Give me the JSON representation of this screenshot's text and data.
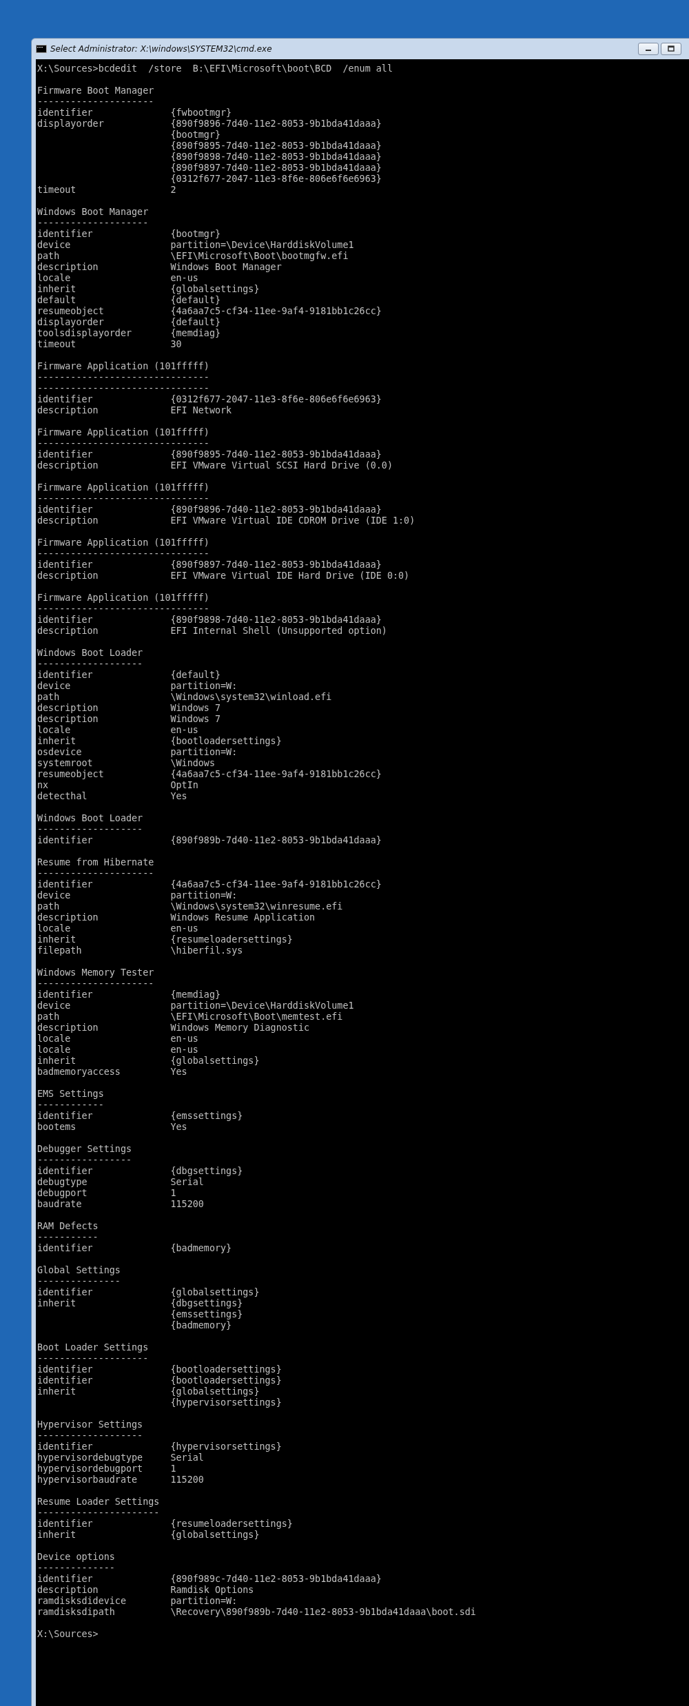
{
  "window": {
    "title": "Select Administrator: X:\\windows\\SYSTEM32\\cmd.exe"
  },
  "console": {
    "command_line": "X:\\Sources>bcdedit  /store  B:\\EFI\\Microsoft\\boot\\BCD  /enum all",
    "sections": [
      {
        "title": "Firmware Boot Manager",
        "rules": [
          "---------------------"
        ],
        "entries": [
          {
            "key": "identifier",
            "value": "{fwbootmgr}"
          },
          {
            "key": "displayorder",
            "value": "{890f9896-7d40-11e2-8053-9b1bda41daaa}"
          },
          {
            "value": "{bootmgr}"
          },
          {
            "value": "{890f9895-7d40-11e2-8053-9b1bda41daaa}"
          },
          {
            "value": "{890f9898-7d40-11e2-8053-9b1bda41daaa}"
          },
          {
            "value": "{890f9897-7d40-11e2-8053-9b1bda41daaa}"
          },
          {
            "value": "{0312f677-2047-11e3-8f6e-806e6f6e6963}"
          },
          {
            "key": "timeout",
            "value": "2"
          }
        ]
      },
      {
        "title": "Windows Boot Manager",
        "rules": [
          "--------------------"
        ],
        "entries": [
          {
            "key": "identifier",
            "value": "{bootmgr}"
          },
          {
            "key": "device",
            "value": "partition=\\Device\\HarddiskVolume1"
          },
          {
            "key": "path",
            "value": "\\EFI\\Microsoft\\Boot\\bootmgfw.efi"
          },
          {
            "key": "description",
            "value": "Windows Boot Manager"
          },
          {
            "key": "locale",
            "value": "en-us"
          },
          {
            "key": "inherit",
            "value": "{globalsettings}"
          },
          {
            "key": "default",
            "value": "{default}"
          },
          {
            "key": "resumeobject",
            "value": "{4a6aa7c5-cf34-11ee-9af4-9181bb1c26cc}"
          },
          {
            "key": "displayorder",
            "value": "{default}"
          },
          {
            "key": "toolsdisplayorder",
            "value": "{memdiag}"
          },
          {
            "key": "timeout",
            "value": "30"
          }
        ]
      },
      {
        "title": "Firmware Application (101fffff)",
        "rules": [
          "-------------------------------",
          "-------------------------------"
        ],
        "entries": [
          {
            "key": "identifier",
            "value": "{0312f677-2047-11e3-8f6e-806e6f6e6963}"
          },
          {
            "key": "description",
            "value": "EFI Network"
          }
        ]
      },
      {
        "title": "Firmware Application (101fffff)",
        "rules": [
          "-------------------------------"
        ],
        "entries": [
          {
            "key": "identifier",
            "value": "{890f9895-7d40-11e2-8053-9b1bda41daaa}"
          },
          {
            "key": "description",
            "value": "EFI VMware Virtual SCSI Hard Drive (0.0)"
          }
        ]
      },
      {
        "title": "Firmware Application (101fffff)",
        "rules": [
          "-------------------------------"
        ],
        "entries": [
          {
            "key": "identifier",
            "value": "{890f9896-7d40-11e2-8053-9b1bda41daaa}"
          },
          {
            "key": "description",
            "value": "EFI VMware Virtual IDE CDROM Drive (IDE 1:0)"
          }
        ]
      },
      {
        "title": "Firmware Application (101fffff)",
        "rules": [
          "-------------------------------"
        ],
        "entries": [
          {
            "key": "identifier",
            "value": "{890f9897-7d40-11e2-8053-9b1bda41daaa}"
          },
          {
            "key": "description",
            "value": "EFI VMware Virtual IDE Hard Drive (IDE 0:0)"
          }
        ]
      },
      {
        "title": "Firmware Application (101fffff)",
        "rules": [
          "-------------------------------"
        ],
        "entries": [
          {
            "key": "identifier",
            "value": "{890f9898-7d40-11e2-8053-9b1bda41daaa}"
          },
          {
            "key": "description",
            "value": "EFI Internal Shell (Unsupported option)"
          }
        ]
      },
      {
        "title": "Windows Boot Loader",
        "rules": [
          "-------------------"
        ],
        "entries": [
          {
            "key": "identifier",
            "value": "{default}"
          },
          {
            "key": "device",
            "value": "partition=W:"
          },
          {
            "key": "path",
            "value": "\\Windows\\system32\\winload.efi"
          },
          {
            "key": "description",
            "value": "Windows 7"
          },
          {
            "key": "description",
            "value": "Windows 7"
          },
          {
            "key": "locale",
            "value": "en-us"
          },
          {
            "key": "inherit",
            "value": "{bootloadersettings}"
          },
          {
            "key": "osdevice",
            "value": "partition=W:"
          },
          {
            "key": "systemroot",
            "value": "\\Windows"
          },
          {
            "key": "resumeobject",
            "value": "{4a6aa7c5-cf34-11ee-9af4-9181bb1c26cc}"
          },
          {
            "key": "nx",
            "value": "OptIn"
          },
          {
            "key": "detecthal",
            "value": "Yes"
          }
        ]
      },
      {
        "title": "Windows Boot Loader",
        "rules": [
          "-------------------"
        ],
        "entries": [
          {
            "key": "identifier",
            "value": "{890f989b-7d40-11e2-8053-9b1bda41daaa}"
          }
        ]
      },
      {
        "title": "Resume from Hibernate",
        "rules": [
          "---------------------"
        ],
        "entries": [
          {
            "key": "identifier",
            "value": "{4a6aa7c5-cf34-11ee-9af4-9181bb1c26cc}"
          },
          {
            "key": "device",
            "value": "partition=W:"
          },
          {
            "key": "path",
            "value": "\\Windows\\system32\\winresume.efi"
          },
          {
            "key": "description",
            "value": "Windows Resume Application"
          },
          {
            "key": "locale",
            "value": "en-us"
          },
          {
            "key": "inherit",
            "value": "{resumeloadersettings}"
          },
          {
            "key": "filepath",
            "value": "\\hiberfil.sys"
          }
        ]
      },
      {
        "title": "Windows Memory Tester",
        "rules": [
          "---------------------"
        ],
        "entries": [
          {
            "key": "identifier",
            "value": "{memdiag}"
          },
          {
            "key": "device",
            "value": "partition=\\Device\\HarddiskVolume1"
          },
          {
            "key": "path",
            "value": "\\EFI\\Microsoft\\Boot\\memtest.efi"
          },
          {
            "key": "description",
            "value": "Windows Memory Diagnostic"
          },
          {
            "key": "locale",
            "value": "en-us"
          },
          {
            "key": "locale",
            "value": "en-us"
          },
          {
            "key": "inherit",
            "value": "{globalsettings}"
          },
          {
            "key": "badmemoryaccess",
            "value": "Yes"
          }
        ]
      },
      {
        "title": "EMS Settings",
        "rules": [
          "------------"
        ],
        "entries": [
          {
            "key": "identifier",
            "value": "{emssettings}"
          },
          {
            "key": "bootems",
            "value": "Yes"
          }
        ]
      },
      {
        "title": "Debugger Settings",
        "rules": [
          "-----------------"
        ],
        "entries": [
          {
            "key": "identifier",
            "value": "{dbgsettings}"
          },
          {
            "key": "debugtype",
            "value": "Serial"
          },
          {
            "key": "debugport",
            "value": "1"
          },
          {
            "key": "baudrate",
            "value": "115200"
          }
        ]
      },
      {
        "title": "RAM Defects",
        "rules": [
          "-----------"
        ],
        "entries": [
          {
            "key": "identifier",
            "value": "{badmemory}"
          }
        ]
      },
      {
        "title": "Global Settings",
        "rules": [
          "---------------"
        ],
        "entries": [
          {
            "key": "identifier",
            "value": "{globalsettings}"
          },
          {
            "key": "inherit",
            "value": "{dbgsettings}"
          },
          {
            "value": "{emssettings}"
          },
          {
            "value": "{badmemory}"
          }
        ]
      },
      {
        "title": "Boot Loader Settings",
        "rules": [
          "--------------------"
        ],
        "entries": [
          {
            "key": "identifier",
            "value": "{bootloadersettings}"
          },
          {
            "key": "identifier",
            "value": "{bootloadersettings}"
          },
          {
            "key": "inherit",
            "value": "{globalsettings}"
          },
          {
            "value": "{hypervisorsettings}"
          }
        ]
      },
      {
        "title": "Hypervisor Settings",
        "rules": [
          "-------------------"
        ],
        "entries": [
          {
            "key": "identifier",
            "value": "{hypervisorsettings}"
          },
          {
            "key": "hypervisordebugtype",
            "value": "Serial"
          },
          {
            "key": "hypervisordebugport",
            "value": "1"
          },
          {
            "key": "hypervisorbaudrate",
            "value": "115200"
          }
        ]
      },
      {
        "title": "Resume Loader Settings",
        "rules": [
          "----------------------"
        ],
        "entries": [
          {
            "key": "identifier",
            "value": "{resumeloadersettings}"
          },
          {
            "key": "inherit",
            "value": "{globalsettings}"
          }
        ]
      },
      {
        "title": "Device options",
        "rules": [
          "--------------"
        ],
        "entries": [
          {
            "key": "identifier",
            "value": "{890f989c-7d40-11e2-8053-9b1bda41daaa}"
          },
          {
            "key": "description",
            "value": "Ramdisk Options"
          },
          {
            "key": "ramdisksdidevice",
            "value": "partition=W:"
          },
          {
            "key": "ramdisksdipath",
            "value": "\\Recovery\\890f989b-7d40-11e2-8053-9b1bda41daaa\\boot.sdi"
          }
        ]
      }
    ],
    "prompt": "X:\\Sources>"
  }
}
